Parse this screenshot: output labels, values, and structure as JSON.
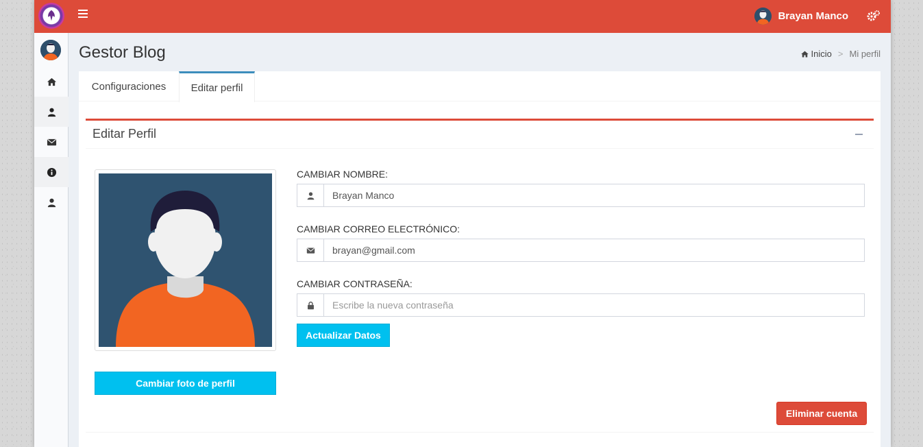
{
  "header": {
    "user_name": "Brayan Manco"
  },
  "page": {
    "title": "Gestor Blog"
  },
  "breadcrumb": {
    "home": "Inicio",
    "separator": ">",
    "current": "Mi perfil"
  },
  "tabs": [
    {
      "label": "Configuraciones"
    },
    {
      "label": "Editar perfil"
    }
  ],
  "panel": {
    "title": "Editar Perfil"
  },
  "form": {
    "name_label": "CAMBIAR NOMBRE:",
    "name_value": "Brayan Manco",
    "email_label": "CAMBIAR CORREO ELECTRÓNICO:",
    "email_value": "brayan@gmail.com",
    "password_label": "CAMBIAR CONTRASEÑA:",
    "password_placeholder": "Escribe la nueva contraseña",
    "update_button": "Actualizar Datos"
  },
  "photo": {
    "change_button": "Cambiar foto de perfil"
  },
  "actions": {
    "delete_button": "Eliminar cuenta"
  },
  "colors": {
    "topbar": "#dd4b39",
    "accent_tab": "#3c8dbc",
    "info_button": "#00c0ef",
    "danger_button": "#dd4b39"
  },
  "icons": {
    "sidebar": [
      "home-icon",
      "user-icon",
      "envelope-icon",
      "info-icon",
      "user-icon"
    ]
  }
}
